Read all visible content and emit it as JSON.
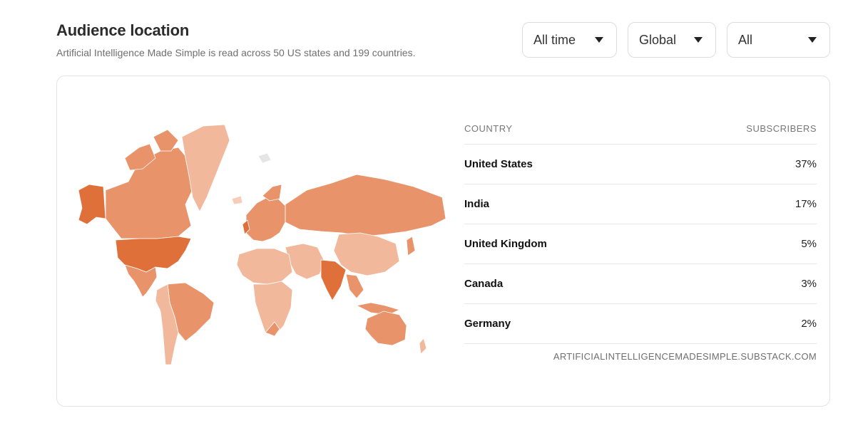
{
  "header": {
    "title": "Audience location",
    "subtitle": "Artificial Intelligence Made Simple is read across 50 US states and 199 countries."
  },
  "filters": {
    "time": "All time",
    "region": "Global",
    "segment": "All"
  },
  "table": {
    "col_country": "COUNTRY",
    "col_subscribers": "SUBSCRIBERS",
    "rows": [
      {
        "country": "United States",
        "subscribers": "37%"
      },
      {
        "country": "India",
        "subscribers": "17%"
      },
      {
        "country": "United Kingdom",
        "subscribers": "5%"
      },
      {
        "country": "Canada",
        "subscribers": "3%"
      },
      {
        "country": "Germany",
        "subscribers": "2%"
      }
    ],
    "source": "ARTIFICIALINTELLIGENCEMADESIMPLE.SUBSTACK.COM"
  },
  "map": {
    "colors": {
      "high": "#e0703a",
      "medium": "#e8936a",
      "low": "#f1b89b",
      "lowest": "#f5cdb8",
      "none": "#e5e5e5"
    }
  }
}
